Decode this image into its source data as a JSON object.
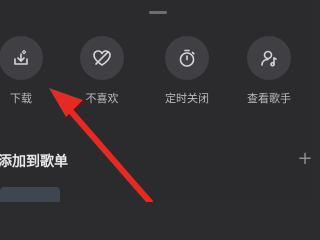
{
  "sheet": {
    "actions": [
      {
        "label": "下载",
        "icon": "download-icon"
      },
      {
        "label": "不喜欢",
        "icon": "broken-heart-icon"
      },
      {
        "label": "定时关闭",
        "icon": "timer-icon"
      },
      {
        "label": "查看歌手",
        "icon": "singer-icon"
      }
    ],
    "section_title": "添加到歌单",
    "add_label": "+"
  },
  "colors": {
    "background": "#2b2b2d",
    "icon_circle": "#404044",
    "annotation_arrow": "#e42a22"
  }
}
